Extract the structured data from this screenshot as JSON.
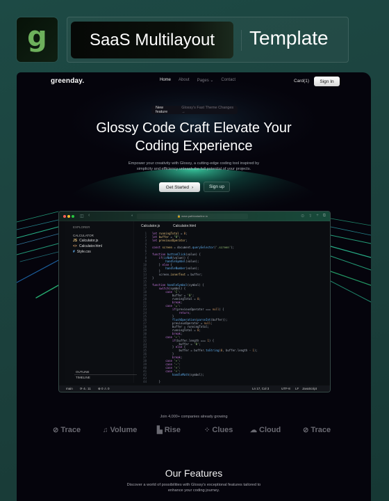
{
  "header": {
    "logo_letter": "g",
    "title_left": "SaaS Multilayout",
    "title_right": "Template"
  },
  "nav": {
    "brand": "greenday.",
    "links": [
      "Home",
      "About",
      "Pages ⌄",
      "Contact"
    ],
    "active": "Home",
    "cart": "Card(1)",
    "signin": "Sign In"
  },
  "hero": {
    "badge_label": "New feature",
    "badge_text": "Glossy's Fast Theme Changes →",
    "title_line1": "Glossy Code Craft Elevate Your",
    "title_line2": "Coding Experience",
    "subtitle_line1": "Empower your creativity with Glossy, a cutting-edge coding tool inspired by",
    "subtitle_line2": "simplicity and efficiency unleash the full potential of your projects.",
    "primary_button": "Get Started",
    "primary_icon": "›",
    "secondary_button": "Sign up"
  },
  "ide": {
    "url": "🔒 www.pathtostarline.io",
    "explorer_label": "EXPLORER",
    "folder": "CALCULATOR",
    "files": [
      {
        "icon": "JS",
        "name": "Calculator.js",
        "color": "#e5c07b"
      },
      {
        "icon": "<>",
        "name": "Calculator.html",
        "color": "#d19a66"
      },
      {
        "icon": "#",
        "name": "Style.css",
        "color": "#61afef"
      }
    ],
    "outline": "OUTLINE",
    "timeline": "TIMELINE",
    "tabs": [
      "Calculator.js",
      "Calculator.html"
    ],
    "status": {
      "branch": "main",
      "sync": "⟳ 4↓ 11",
      "errors": "⊗ 0  ⚠ 0",
      "position": "Ln 17, Col 3",
      "encoding": "UTF-8",
      "eol": "LF",
      "language": "JavaScript"
    }
  },
  "companies": {
    "heading": "Join 4,000+ companies already growing",
    "logos": [
      {
        "icon": "compass-icon",
        "glyph": "⊘",
        "name": "Trace"
      },
      {
        "icon": "music-icon",
        "glyph": "♫",
        "name": "Volume"
      },
      {
        "icon": "chart-icon",
        "glyph": "▙",
        "name": "Rise"
      },
      {
        "icon": "paw-icon",
        "glyph": "⁘",
        "name": "Clues"
      },
      {
        "icon": "cloud-icon",
        "glyph": "☁",
        "name": "Cloud"
      },
      {
        "icon": "compass-icon",
        "glyph": "⊘",
        "name": "Trace"
      }
    ]
  },
  "features": {
    "title": "Our Features",
    "subtitle_line1": "Discover a world of possibilities with Glossy's exceptional features tailored to",
    "subtitle_line2": "enhance your coding journey."
  },
  "code_lines": [
    [
      [
        "kw",
        "let "
      ],
      [
        "vr",
        "runningTotal"
      ],
      [
        "pl",
        " = "
      ],
      [
        "nm",
        "0"
      ],
      [
        "pl",
        ";"
      ]
    ],
    [
      [
        "kw",
        "let "
      ],
      [
        "vr",
        "buffer"
      ],
      [
        "pl",
        " = "
      ],
      [
        "st",
        "\"0\""
      ],
      [
        "pl",
        ";"
      ]
    ],
    [
      [
        "kw",
        "let "
      ],
      [
        "vr",
        "previousOperator"
      ],
      [
        "pl",
        ";"
      ]
    ],
    [],
    [
      [
        "kw",
        "const "
      ],
      [
        "vr",
        "screen"
      ],
      [
        "pl",
        " = document."
      ],
      [
        "fn",
        "querySelector"
      ],
      [
        "pl",
        "("
      ],
      [
        "st",
        "'.screen'"
      ],
      [
        "pl",
        ");"
      ]
    ],
    [],
    [
      [
        "kw",
        "function "
      ],
      [
        "fn",
        "buttonClick"
      ],
      [
        "pl",
        "(value) {"
      ]
    ],
    [
      [
        "pl",
        "    "
      ],
      [
        "kw",
        "if"
      ],
      [
        "pl",
        "("
      ],
      [
        "fn",
        "isNaN"
      ],
      [
        "pl",
        "(value)) {"
      ]
    ],
    [
      [
        "pl",
        "        "
      ],
      [
        "fn",
        "handleSymbol"
      ],
      [
        "pl",
        "(value);"
      ]
    ],
    [
      [
        "pl",
        "    } "
      ],
      [
        "kw",
        "else"
      ],
      [
        "pl",
        " {"
      ]
    ],
    [
      [
        "pl",
        "        "
      ],
      [
        "fn",
        "handleNumber"
      ],
      [
        "pl",
        "(value);"
      ]
    ],
    [
      [
        "pl",
        "    }"
      ]
    ],
    [
      [
        "pl",
        "    screen."
      ],
      [
        "vr",
        "innerText"
      ],
      [
        "pl",
        " = buffer;"
      ]
    ],
    [
      [
        "pl",
        "}"
      ]
    ],
    [],
    [
      [
        "kw",
        "function "
      ],
      [
        "fn",
        "handleSymbol"
      ],
      [
        "pl",
        "(symbol) {"
      ]
    ],
    [
      [
        "pl",
        "    "
      ],
      [
        "kw",
        "switch"
      ],
      [
        "pl",
        "(symbol) {"
      ]
    ],
    [
      [
        "pl",
        "        "
      ],
      [
        "kw",
        "case "
      ],
      [
        "st",
        "'C'"
      ],
      [
        "pl",
        ":"
      ]
    ],
    [
      [
        "pl",
        "            buffer = "
      ],
      [
        "st",
        "'0'"
      ],
      [
        "pl",
        ";"
      ]
    ],
    [
      [
        "pl",
        "            runningTotal = "
      ],
      [
        "nm",
        "0"
      ],
      [
        "pl",
        ";"
      ]
    ],
    [
      [
        "pl",
        "            "
      ],
      [
        "kw",
        "break"
      ],
      [
        "pl",
        ";"
      ]
    ],
    [
      [
        "pl",
        "        "
      ],
      [
        "kw",
        "case "
      ],
      [
        "st",
        "'='"
      ],
      [
        "pl",
        ":"
      ]
    ],
    [
      [
        "pl",
        "            "
      ],
      [
        "kw",
        "if"
      ],
      [
        "pl",
        "(previousOperator === "
      ],
      [
        "nm",
        "null"
      ],
      [
        "pl",
        ") {"
      ]
    ],
    [
      [
        "pl",
        "                "
      ],
      [
        "kw",
        "return"
      ],
      [
        "pl",
        ";"
      ]
    ],
    [
      [
        "pl",
        "            }"
      ]
    ],
    [
      [
        "pl",
        "            "
      ],
      [
        "fn",
        "flushOperation"
      ],
      [
        "pl",
        "("
      ],
      [
        "fn",
        "parseInt"
      ],
      [
        "pl",
        "(buffer));"
      ]
    ],
    [
      [
        "pl",
        "            previousOperator = "
      ],
      [
        "nm",
        "null"
      ],
      [
        "pl",
        ";"
      ]
    ],
    [
      [
        "pl",
        "            buffer = runningTotal;"
      ]
    ],
    [
      [
        "pl",
        "            runningTotal = "
      ],
      [
        "nm",
        "0"
      ],
      [
        "pl",
        ";"
      ]
    ],
    [
      [
        "pl",
        "            "
      ],
      [
        "kw",
        "break"
      ],
      [
        "pl",
        ";"
      ]
    ],
    [
      [
        "pl",
        "        "
      ],
      [
        "kw",
        "case "
      ],
      [
        "st",
        "'←'"
      ],
      [
        "pl",
        ":"
      ]
    ],
    [
      [
        "pl",
        "            "
      ],
      [
        "kw",
        "if"
      ],
      [
        "pl",
        "(buffer.length === "
      ],
      [
        "nm",
        "1"
      ],
      [
        "pl",
        ") {"
      ]
    ],
    [
      [
        "pl",
        "                buffer = "
      ],
      [
        "st",
        "'0'"
      ],
      [
        "pl",
        ";"
      ]
    ],
    [
      [
        "pl",
        "            } "
      ],
      [
        "kw",
        "else"
      ],
      [
        "pl",
        " {"
      ]
    ],
    [
      [
        "pl",
        "                buffer = buffer."
      ],
      [
        "fn",
        "toString"
      ],
      [
        "pl",
        "("
      ],
      [
        "nm",
        "0"
      ],
      [
        "pl",
        ", buffer.length - "
      ],
      [
        "nm",
        "1"
      ],
      [
        "pl",
        ");"
      ]
    ],
    [
      [
        "pl",
        "            }"
      ]
    ],
    [
      [
        "pl",
        "            "
      ],
      [
        "kw",
        "break"
      ],
      [
        "pl",
        ";"
      ]
    ],
    [
      [
        "pl",
        "        "
      ],
      [
        "kw",
        "case "
      ],
      [
        "st",
        "'+'"
      ],
      [
        "pl",
        ":"
      ]
    ],
    [
      [
        "pl",
        "        "
      ],
      [
        "kw",
        "case "
      ],
      [
        "st",
        "'−'"
      ],
      [
        "pl",
        ":"
      ]
    ],
    [
      [
        "pl",
        "        "
      ],
      [
        "kw",
        "case "
      ],
      [
        "st",
        "'×'"
      ],
      [
        "pl",
        ":"
      ]
    ],
    [
      [
        "pl",
        "        "
      ],
      [
        "kw",
        "case "
      ],
      [
        "st",
        "'÷'"
      ],
      [
        "pl",
        ":"
      ]
    ],
    [
      [
        "pl",
        "            "
      ],
      [
        "fn",
        "handleMath"
      ],
      [
        "pl",
        "(symbol);"
      ]
    ],
    [],
    [
      [
        "pl",
        "    }"
      ]
    ]
  ]
}
